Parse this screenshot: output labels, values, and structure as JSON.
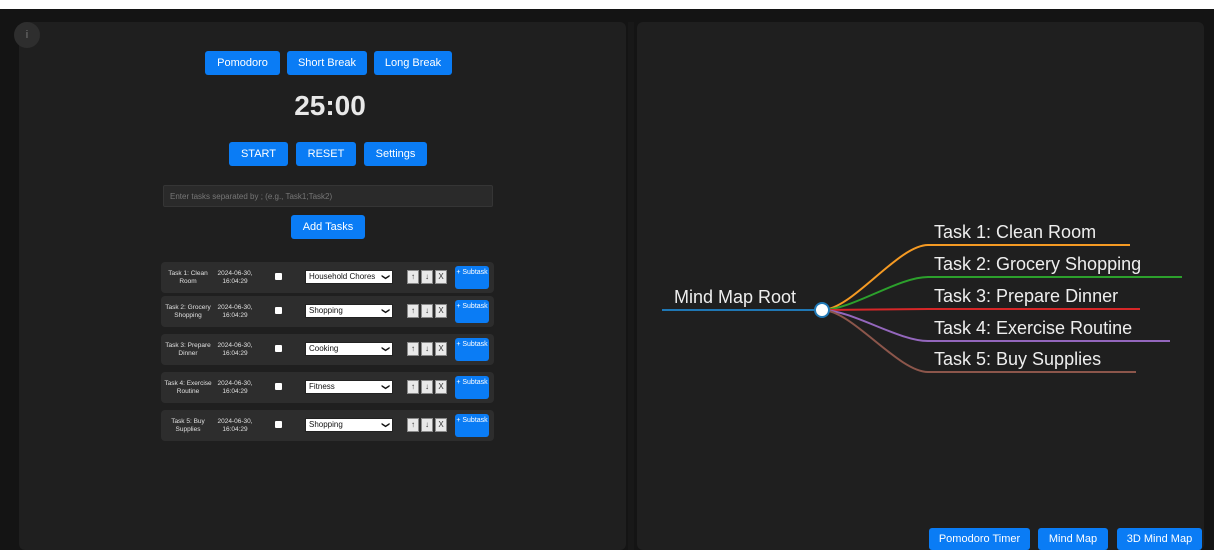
{
  "timer": {
    "modes": [
      "Pomodoro",
      "Short Break",
      "Long Break"
    ],
    "time": "25:00",
    "controls": [
      "START",
      "RESET",
      "Settings"
    ]
  },
  "tasks_input": {
    "placeholder": "Enter tasks separated by ; (e.g., Task1;Task2)",
    "add_label": "Add Tasks"
  },
  "tasks": [
    {
      "name": "Task 1: Clean Room",
      "date": "2024-06-30, 16:04:29",
      "category": "Household Chores"
    },
    {
      "name": "Task 2: Grocery Shopping",
      "date": "2024-06-30, 16:04:29",
      "category": "Shopping"
    },
    {
      "name": "Task 3: Prepare Dinner",
      "date": "2024-06-30, 16:04:29",
      "category": "Cooking"
    },
    {
      "name": "Task 4: Exercise Routine",
      "date": "2024-06-30, 16:04:29",
      "category": "Fitness"
    },
    {
      "name": "Task 5: Buy Supplies",
      "date": "2024-06-30, 16:04:29",
      "category": "Shopping"
    }
  ],
  "task_controls": {
    "up": "↑",
    "down": "↓",
    "delete": "X",
    "subtask": "+ Subtask"
  },
  "mindmap": {
    "root": "Mind Map Root",
    "branches": [
      {
        "label": "Task 1: Clean Room",
        "color": "#f59a23"
      },
      {
        "label": "Task 2: Grocery Shopping",
        "color": "#2ca02c"
      },
      {
        "label": "Task 3: Prepare Dinner",
        "color": "#d62728"
      },
      {
        "label": "Task 4: Exercise Routine",
        "color": "#9467bd"
      },
      {
        "label": "Task 5: Buy Supplies",
        "color": "#8c564b"
      }
    ],
    "root_color": "#1f77b4"
  },
  "nav": {
    "pomodoro": "Pomodoro Timer",
    "mindmap": "Mind Map",
    "mindmap3d": "3D Mind Map"
  },
  "icons": {
    "info": "info-icon"
  }
}
